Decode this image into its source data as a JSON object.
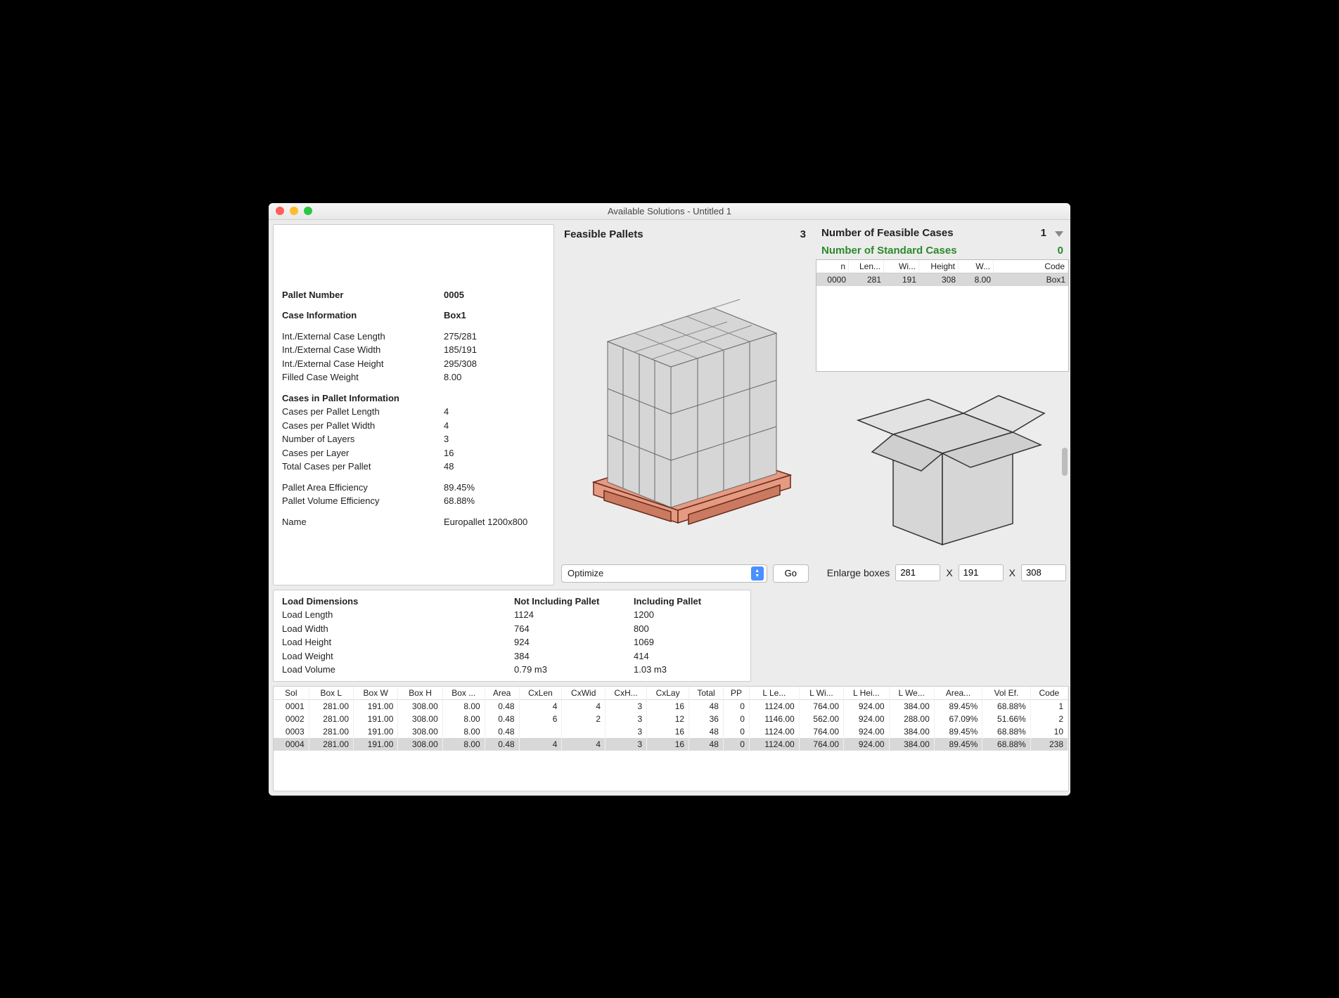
{
  "window": {
    "title": "Available Solutions - Untitled 1"
  },
  "left": {
    "pallet_number_label": "Pallet Number",
    "pallet_number": "0005",
    "case_info_label": "Case Information",
    "case_info": "Box1",
    "specs": [
      {
        "k": "Int./External Case Length",
        "v": "275/281"
      },
      {
        "k": "Int./External Case Width",
        "v": "185/191"
      },
      {
        "k": "Int./External Case Height",
        "v": "295/308"
      },
      {
        "k": "Filled Case Weight",
        "v": "8.00"
      }
    ],
    "cases_in_pallet_label": "Cases in Pallet Information",
    "cases_specs": [
      {
        "k": "Cases per Pallet Length",
        "v": "4"
      },
      {
        "k": "Cases per Pallet Width",
        "v": "4"
      },
      {
        "k": "Number of Layers",
        "v": "3"
      },
      {
        "k": "Cases per Layer",
        "v": "16"
      },
      {
        "k": "Total Cases per Pallet",
        "v": "48"
      }
    ],
    "efficiency": [
      {
        "k": "Pallet Area Efficiency",
        "v": "89.45%"
      },
      {
        "k": "Pallet Volume Efficiency",
        "v": "68.88%"
      }
    ],
    "name_label": "Name",
    "name_value": "Europallet 1200x800"
  },
  "mid": {
    "title": "Feasible Pallets",
    "count": "3",
    "select_value": "Optimize",
    "go_label": "Go"
  },
  "right": {
    "feasible_label": "Number of Feasible Cases",
    "feasible_count": "1",
    "standard_label": "Number of Standard Cases",
    "standard_count": "0",
    "table_headers": [
      "n",
      "Len...",
      "Wi...",
      "Height",
      "W...",
      "Code"
    ],
    "table_row": [
      "0000",
      "281",
      "191",
      "308",
      "8.00",
      "Box1"
    ],
    "enlarge_label": "Enlarge boxes",
    "enlarge": {
      "x": "281",
      "y": "191",
      "z": "308"
    },
    "x_symbol": "X"
  },
  "load": {
    "header": "Load Dimensions",
    "col_a": "Not Including Pallet",
    "col_b": "Including Pallet",
    "rows": [
      {
        "k": "Load Length",
        "a": "1124",
        "b": "1200"
      },
      {
        "k": "Load Width",
        "a": "764",
        "b": "800"
      },
      {
        "k": "Load Height",
        "a": "924",
        "b": "1069"
      },
      {
        "k": "Load Weight",
        "a": "384",
        "b": "414"
      },
      {
        "k": "Load Volume",
        "a": "0.79 m3",
        "b": "1.03 m3"
      }
    ]
  },
  "bottom": {
    "headers": [
      "Sol",
      "Box L",
      "Box W",
      "Box H",
      "Box ...",
      "Area",
      "CxLen",
      "CxWid",
      "CxH...",
      "CxLay",
      "Total",
      "PP",
      "L Le...",
      "L Wi...",
      "L Hei...",
      "L We...",
      "Area...",
      "Vol Ef.",
      "Code"
    ],
    "rows": [
      [
        "0001",
        "281.00",
        "191.00",
        "308.00",
        "8.00",
        "0.48",
        "4",
        "4",
        "3",
        "16",
        "48",
        "0",
        "1124.00",
        "764.00",
        "924.00",
        "384.00",
        "89.45%",
        "68.88%",
        "1"
      ],
      [
        "0002",
        "281.00",
        "191.00",
        "308.00",
        "8.00",
        "0.48",
        "6",
        "2",
        "3",
        "12",
        "36",
        "0",
        "1146.00",
        "562.00",
        "924.00",
        "288.00",
        "67.09%",
        "51.66%",
        "2"
      ],
      [
        "0003",
        "281.00",
        "191.00",
        "308.00",
        "8.00",
        "0.48",
        "",
        "",
        "3",
        "16",
        "48",
        "0",
        "1124.00",
        "764.00",
        "924.00",
        "384.00",
        "89.45%",
        "68.88%",
        "10"
      ],
      [
        "0004",
        "281.00",
        "191.00",
        "308.00",
        "8.00",
        "0.48",
        "4",
        "4",
        "3",
        "16",
        "48",
        "0",
        "1124.00",
        "764.00",
        "924.00",
        "384.00",
        "89.45%",
        "68.88%",
        "238"
      ]
    ],
    "selected": 3
  }
}
